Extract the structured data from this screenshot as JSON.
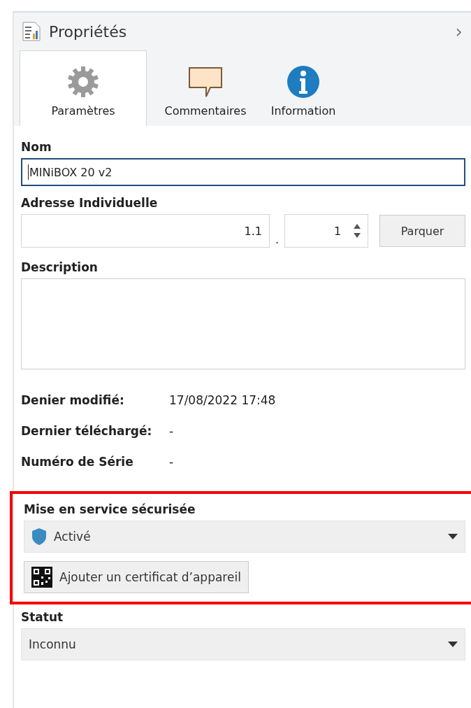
{
  "panel": {
    "title": "Propriétés",
    "collapse_glyph": "›"
  },
  "tabs": [
    {
      "label": "Paramètres",
      "kind": "gear",
      "selected": true
    },
    {
      "label": "Commentaires",
      "kind": "comment",
      "selected": false
    },
    {
      "label": "Information",
      "kind": "info",
      "selected": false
    }
  ],
  "name": {
    "label": "Nom",
    "value": "MINiBOX 20 v2",
    "focused": true
  },
  "address": {
    "label": "Adresse Individuelle",
    "prefix": "1.1",
    "separator": ".",
    "device": "1",
    "button": "Parquer"
  },
  "description": {
    "label": "Description"
  },
  "info_rows": [
    {
      "label": "Denier modifié:",
      "value": "17/08/2022 17:48"
    },
    {
      "label": "Dernier téléchargé:",
      "value": "-"
    },
    {
      "label": "Numéro de Série",
      "value": "-"
    }
  ],
  "secure": {
    "highlighted": true,
    "label": "Mise en service sécurisée",
    "value": "Activé",
    "button": "Ajouter un certificat d’appareil"
  },
  "status": {
    "label": "Statut",
    "value": "Inconnu"
  }
}
